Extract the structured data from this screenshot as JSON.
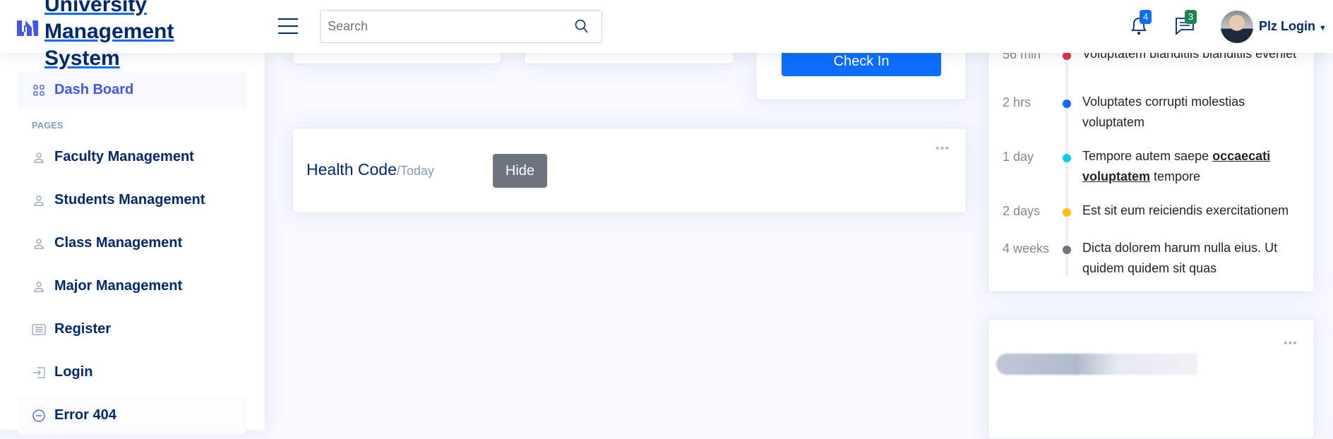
{
  "header": {
    "logo_lines": [
      "University",
      "Management",
      "System"
    ],
    "search": {
      "placeholder": "Search",
      "value": ""
    },
    "notifications": {
      "icon": "bell-icon",
      "count": "4",
      "badge_color": "#0d6efd"
    },
    "messages": {
      "icon": "chat-icon",
      "count": "3",
      "badge_color": "#198754"
    },
    "user": {
      "name": "Plz Login"
    }
  },
  "sidebar": {
    "active": {
      "label": "Dash Board",
      "icon": "grid-icon"
    },
    "section": "PAGES",
    "items": [
      {
        "label": "Faculty Management",
        "icon": "person-icon"
      },
      {
        "label": "Students Management",
        "icon": "person-icon"
      },
      {
        "label": "Class Management",
        "icon": "person-icon"
      },
      {
        "label": "Major Management",
        "icon": "person-icon"
      },
      {
        "label": "Register",
        "icon": "card-list-icon"
      },
      {
        "label": "Login",
        "icon": "box-arrow-in-icon"
      },
      {
        "label": "Error 404",
        "icon": "dash-circle-icon"
      }
    ]
  },
  "main": {
    "checkin_label": "Check In",
    "health": {
      "title": "Health Code",
      "subtitle": "/Today",
      "hide_label": "Hide"
    }
  },
  "timeline": {
    "items": [
      {
        "time": "56 min",
        "text": "Voluptatem blanditiis blanditiis eveniet",
        "color": "#dc3545"
      },
      {
        "time": "2 hrs",
        "text": "Voluptates corrupti molestias voluptatem",
        "color": "#0d6efd"
      },
      {
        "time": "1 day",
        "text_before": "Tempore autem saepe ",
        "link": "occaecati voluptatem",
        "text_after": " tempore",
        "color": "#0dcaf0"
      },
      {
        "time": "2 days",
        "text": "Est sit eum reiciendis exercitationem",
        "color": "#ffc107"
      },
      {
        "time": "4 weeks",
        "text": "Dicta dolorem harum nulla eius. Ut quidem quidem sit quas",
        "color": "#6c757d"
      }
    ]
  },
  "colors": {
    "primary": "#0d6efd",
    "navy": "#012970",
    "accent": "#4154f1",
    "secondary": "#6c757d"
  }
}
